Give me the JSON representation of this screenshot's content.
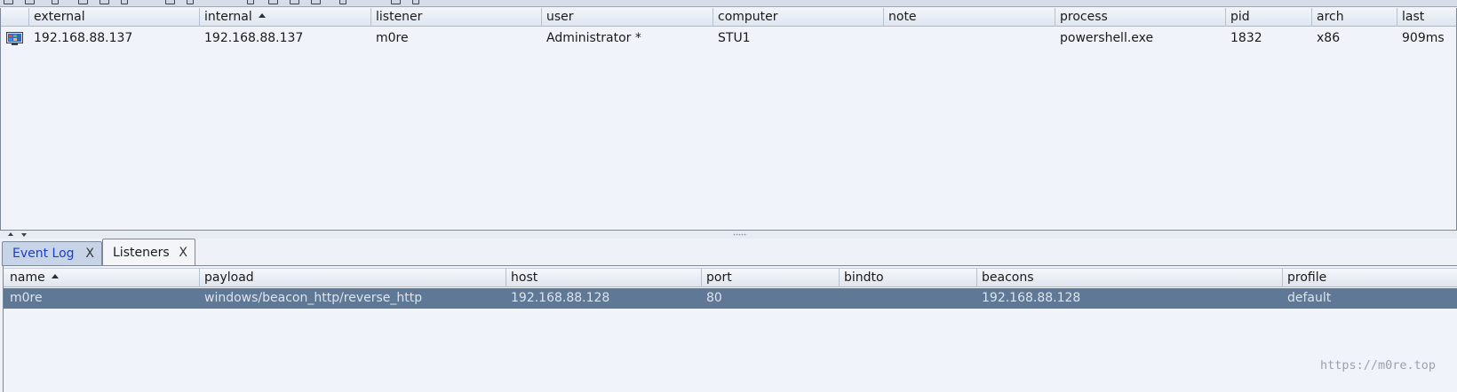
{
  "beacons": {
    "columns": [
      {
        "key": "icon",
        "label": ""
      },
      {
        "key": "external",
        "label": "external"
      },
      {
        "key": "internal",
        "label": "internal",
        "sorted": "asc"
      },
      {
        "key": "listener",
        "label": "listener"
      },
      {
        "key": "user",
        "label": "user"
      },
      {
        "key": "computer",
        "label": "computer"
      },
      {
        "key": "note",
        "label": "note"
      },
      {
        "key": "process",
        "label": "process"
      },
      {
        "key": "pid",
        "label": "pid"
      },
      {
        "key": "arch",
        "label": "arch"
      },
      {
        "key": "last",
        "label": "last"
      }
    ],
    "rows": [
      {
        "icon": "windows-beacon-icon",
        "external": "192.168.88.137",
        "internal": "192.168.88.137",
        "listener": "m0re",
        "user": "Administrator *",
        "computer": "STU1",
        "note": "",
        "process": "powershell.exe",
        "pid": "1832",
        "arch": "x86",
        "last": "909ms"
      }
    ]
  },
  "tabs": [
    {
      "label": "Event Log",
      "close": "X",
      "active": false
    },
    {
      "label": "Listeners",
      "close": "X",
      "active": true
    }
  ],
  "listeners": {
    "columns": [
      {
        "key": "name",
        "label": "name",
        "sorted": "asc"
      },
      {
        "key": "payload",
        "label": "payload"
      },
      {
        "key": "host",
        "label": "host"
      },
      {
        "key": "port",
        "label": "port"
      },
      {
        "key": "bindto",
        "label": "bindto"
      },
      {
        "key": "beacons",
        "label": "beacons"
      },
      {
        "key": "profile",
        "label": "profile"
      }
    ],
    "rows": [
      {
        "name": "m0re",
        "payload": "windows/beacon_http/reverse_http",
        "host": "192.168.88.128",
        "port": "80",
        "bindto": "",
        "beacons": "192.168.88.128",
        "profile": "default",
        "selected": true
      }
    ]
  },
  "watermark": "https://m0re.top",
  "colors": {
    "selection": "#5f7896",
    "tab_inactive": "#c7d3e6",
    "tab_link_text": "#1a3fc1"
  }
}
